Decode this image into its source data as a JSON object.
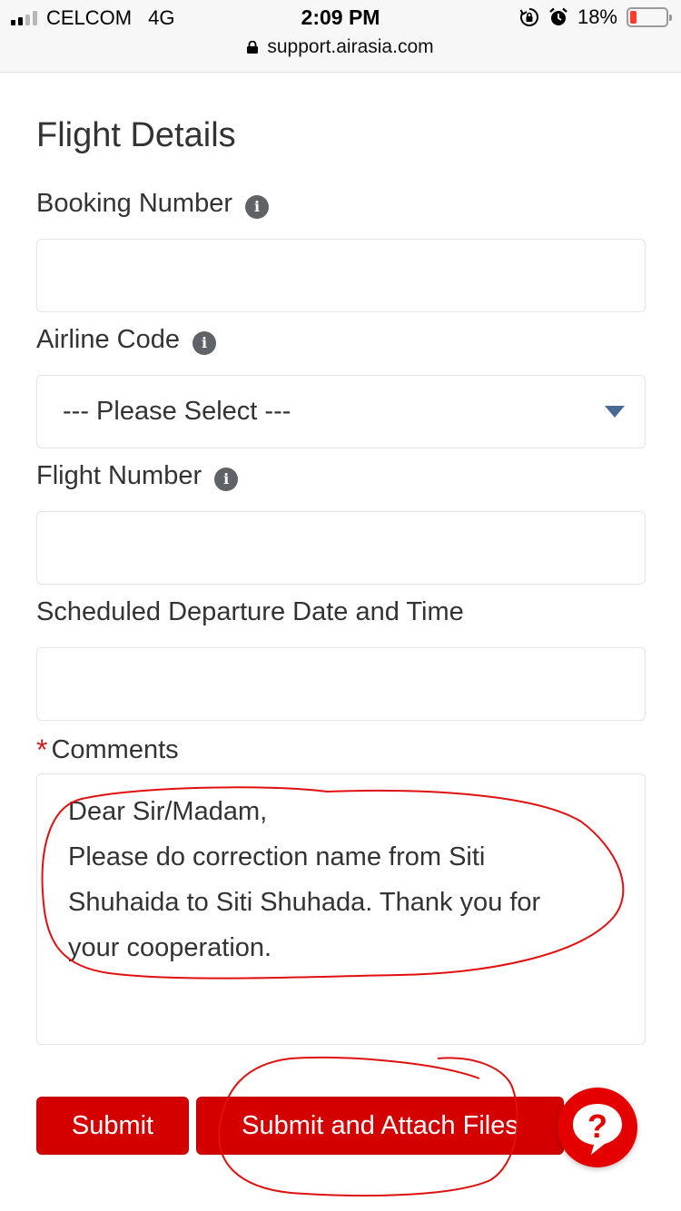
{
  "status_bar": {
    "carrier": "CELCOM",
    "network": "4G",
    "time": "2:09 PM",
    "battery_percent": "18%",
    "battery_level": 0.18,
    "url": "support.airasia.com"
  },
  "form": {
    "section_title": "Flight Details",
    "booking_number": {
      "label": "Booking Number",
      "value": ""
    },
    "airline_code": {
      "label": "Airline Code",
      "selected": "--- Please Select ---"
    },
    "flight_number": {
      "label": "Flight Number",
      "value": ""
    },
    "departure": {
      "label": "Scheduled Departure Date and Time",
      "value": ""
    },
    "comments": {
      "required_marker": "*",
      "label": "Comments",
      "lines": [
        "Dear Sir/Madam,",
        "Please do correction name from Siti",
        "Shuhaida to Siti Shuhada. Thank you for",
        "your cooperation."
      ]
    }
  },
  "buttons": {
    "submit": "Submit",
    "submit_attach": "Submit and Attach Files"
  },
  "help_button": {
    "icon": "question-mark-chat-icon",
    "glyph": "?"
  },
  "colors": {
    "brand_red": "#d40000",
    "annotation_red": "#e01010",
    "caret_blue": "#4a6a96"
  }
}
